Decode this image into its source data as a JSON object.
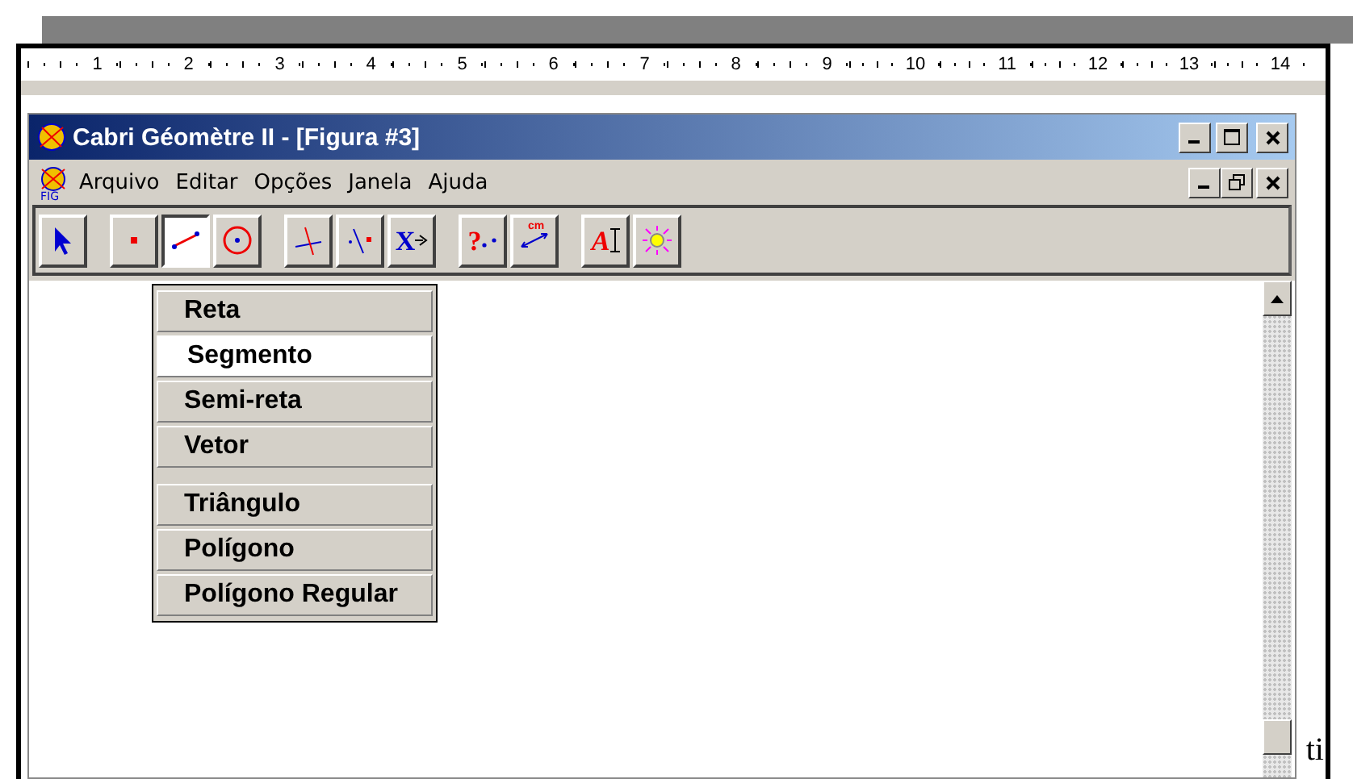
{
  "ruler": {
    "numbers": [
      "1",
      "2",
      "3",
      "4",
      "5",
      "6",
      "7",
      "8",
      "9",
      "10",
      "11",
      "12",
      "13",
      "14"
    ]
  },
  "window": {
    "title": "Cabri Géomètre II - [Figura  #3]"
  },
  "menu_bar": {
    "doc_icon_label": "FIG",
    "items": [
      "Arquivo",
      "Editar",
      "Opções",
      "Janela",
      "Ajuda"
    ]
  },
  "toolbar": {
    "groups": [
      [
        {
          "selected": false
        }
      ],
      [
        {
          "selected": false
        },
        {
          "selected": true
        },
        {
          "selected": false
        }
      ],
      [
        {
          "selected": false
        },
        {
          "selected": false
        },
        {
          "selected": false,
          "label": "X"
        }
      ],
      [
        {
          "selected": false,
          "label": "?"
        },
        {
          "selected": false,
          "label": "cm"
        }
      ],
      [
        {
          "selected": false,
          "label": "A"
        },
        {
          "selected": false
        }
      ]
    ]
  },
  "dropdown": {
    "groups": [
      [
        {
          "label": "Reta",
          "selected": false
        },
        {
          "label": "Segmento",
          "selected": true
        },
        {
          "label": "Semi-reta",
          "selected": false
        },
        {
          "label": "Vetor",
          "selected": false
        }
      ],
      [
        {
          "label": "Triângulo",
          "selected": false
        },
        {
          "label": "Polígono",
          "selected": false
        },
        {
          "label": "Polígono Regular",
          "selected": false
        }
      ]
    ]
  },
  "document_text": "ti"
}
